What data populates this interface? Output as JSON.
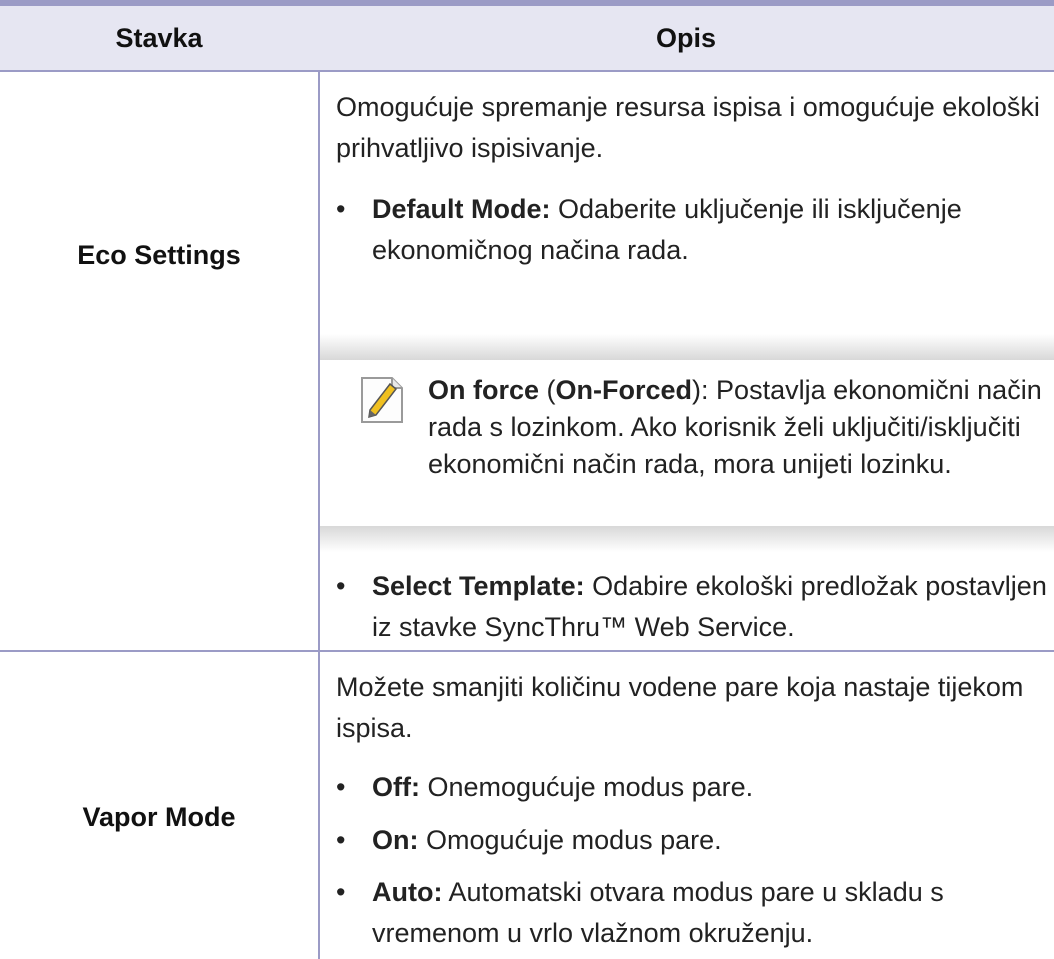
{
  "table": {
    "headers": {
      "item": "Stavka",
      "description": "Opis"
    },
    "rows": [
      {
        "item": "Eco Settings",
        "intro": "Omogućuje spremanje resursa ispisa i omogućuje ekološki prihvatljivo ispisivanje.",
        "bullets": [
          {
            "term": "Default Mode:",
            "text": " Odaberite uključenje ili isključenje ekonomičnog načina rada."
          }
        ],
        "note": {
          "term": "On force",
          "paren_open": " (",
          "term2": "On-Forced",
          "text": "): Postavlja ekonomični način rada s lozinkom. Ako korisnik želi uključiti/isključiti ekonomični način rada, mora unijeti lozinku."
        },
        "bullets_after": [
          {
            "term": "Select Template:",
            "text": " Odabire ekološki predložak postavljen iz stavke SyncThru™ Web Service."
          }
        ]
      },
      {
        "item": "Vapor Mode",
        "intro": "Možete smanjiti količinu vodene pare koja nastaje tijekom ispisa.",
        "bullets": [
          {
            "term": "Off:",
            "text": " Onemogućuje modus pare."
          },
          {
            "term": "On:",
            "text": " Omogućuje modus pare."
          },
          {
            "term": "Auto:",
            "text": " Automatski otvara modus pare u skladu s vremenom u vrlo vlažnom okruženju."
          }
        ]
      }
    ]
  },
  "colors": {
    "rule": "#9b9bc6",
    "header_bg": "#e6e6f2",
    "note_shade": "#d8d8d8",
    "note_icon": "#f0c020"
  },
  "icons": {
    "note": "note-pencil-icon"
  }
}
